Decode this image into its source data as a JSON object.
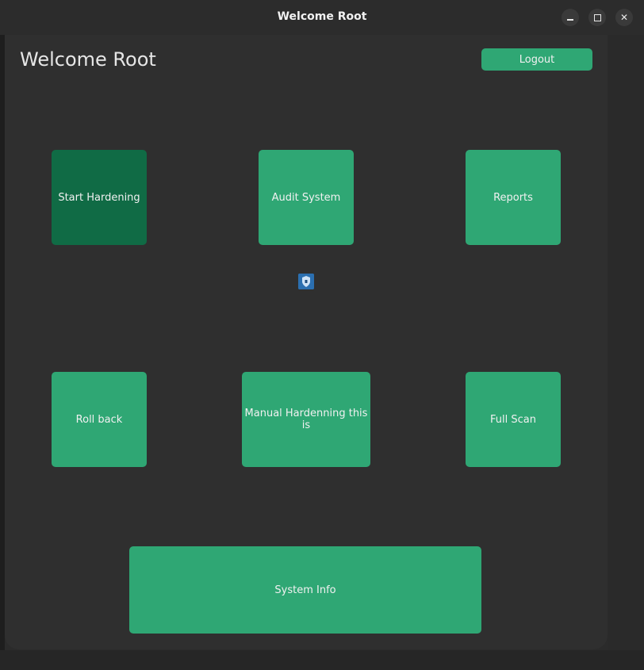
{
  "window": {
    "title": "Welcome Root",
    "controls": [
      "minimize-icon",
      "maximize-icon",
      "close-icon"
    ]
  },
  "header": {
    "welcome_text": "Welcome Root",
    "logout_label": "Logout"
  },
  "buttons": {
    "start_hardening": "Start Hardening",
    "audit_system": "Audit System",
    "reports": "Reports",
    "roll_back": "Roll back",
    "manual_hardening": "Manual Hardenning this is",
    "full_scan": "Full Scan",
    "system_info": "System Info"
  },
  "colors": {
    "accent": "#2fa774",
    "accent_active": "#106b45",
    "background": "#2f2f2f"
  },
  "logo": "shield-logo-icon"
}
